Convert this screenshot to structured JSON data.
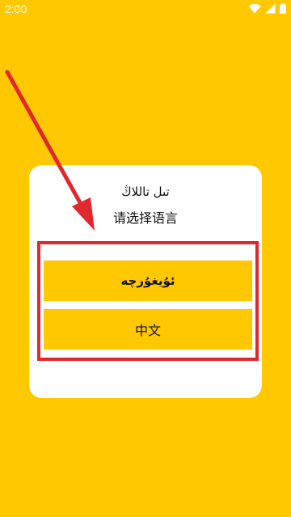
{
  "status_bar": {
    "time": "2:00",
    "icons": [
      "wifi-icon",
      "signal-icon",
      "battery-icon"
    ]
  },
  "dialog": {
    "title_uyghur": "تىل تاللاڭ",
    "title_chinese": "请选择语言",
    "options": [
      {
        "label": "ئۇيغۇرچە"
      },
      {
        "label": "中文"
      }
    ]
  },
  "colors": {
    "background": "#FFC800",
    "dialog_bg": "#FFFFFF",
    "button_bg": "#FFC800",
    "annotation": "#E0282E"
  }
}
